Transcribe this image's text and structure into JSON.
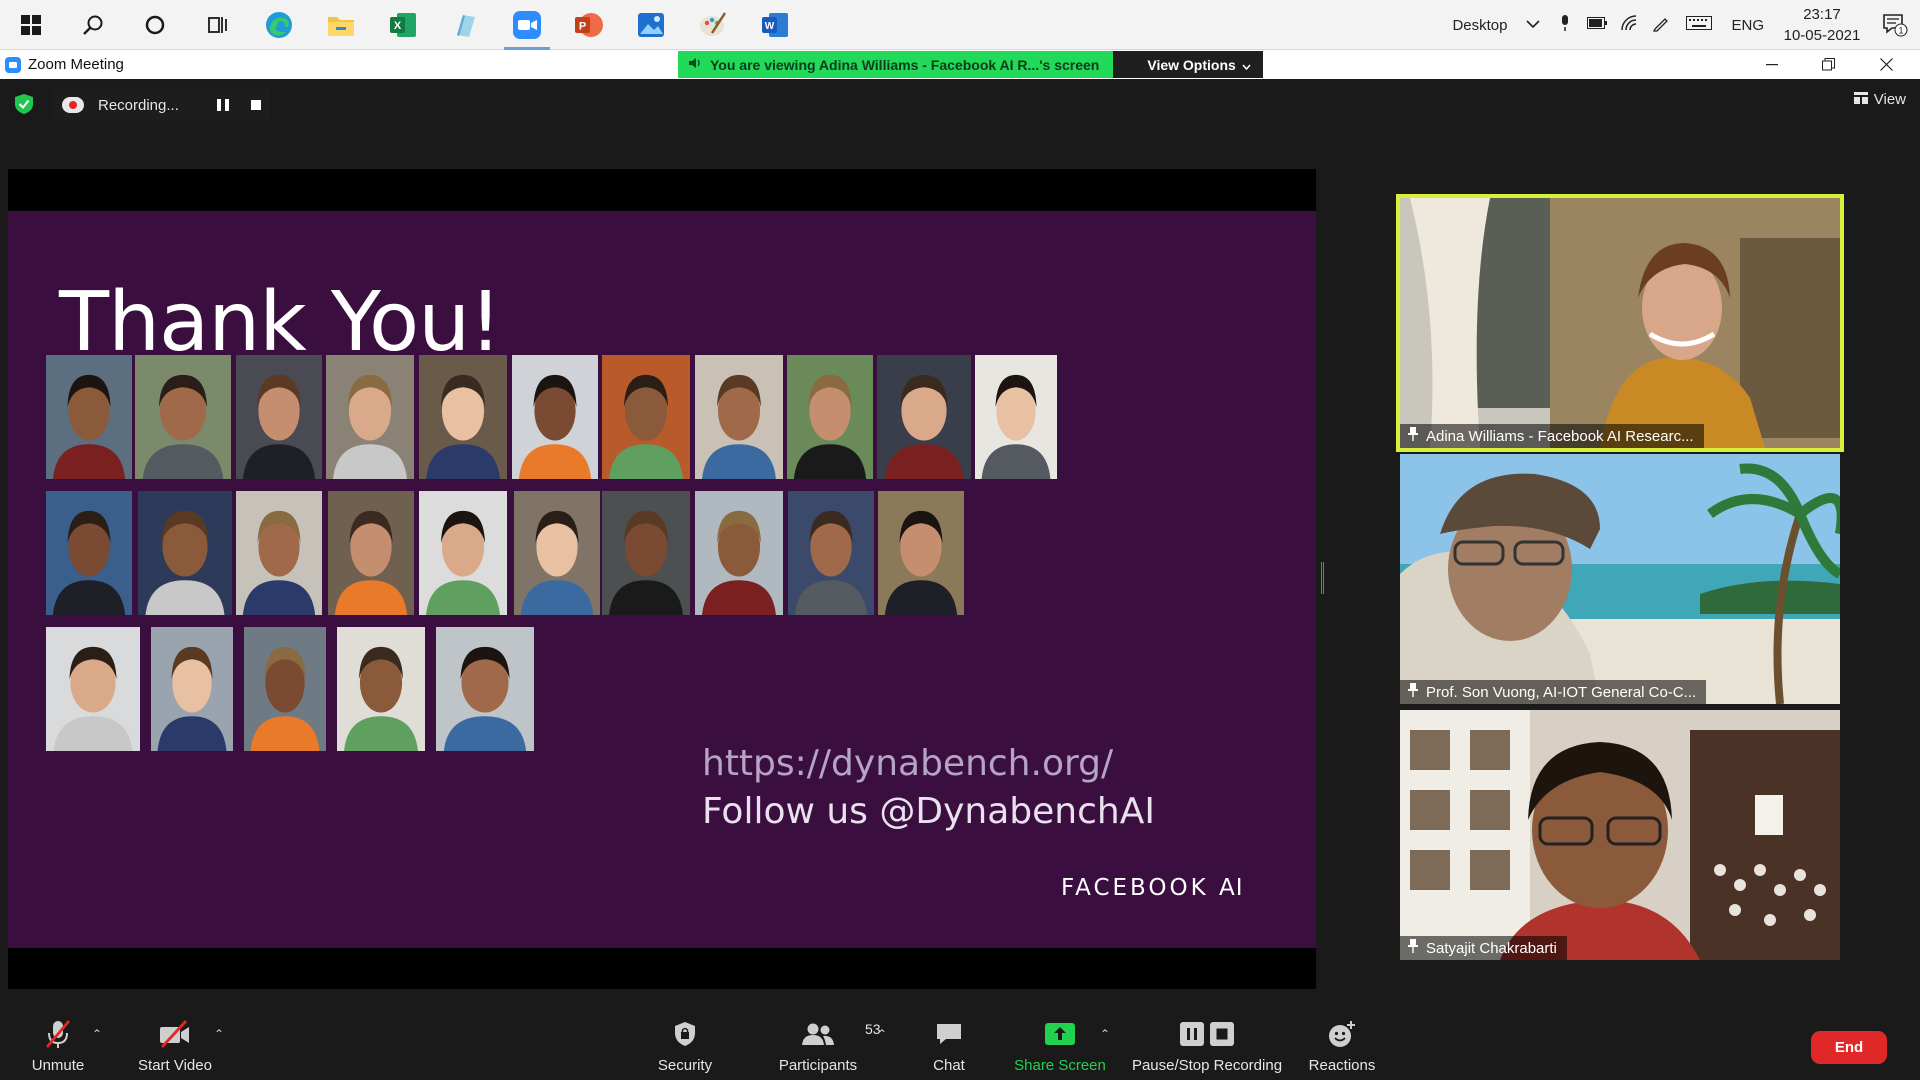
{
  "taskbar": {
    "apps": [
      {
        "name": "start-icon"
      },
      {
        "name": "search-icon"
      },
      {
        "name": "cortana-icon"
      },
      {
        "name": "task-view-icon"
      },
      {
        "name": "edge-icon"
      },
      {
        "name": "file-explorer-icon"
      },
      {
        "name": "excel-icon"
      },
      {
        "name": "generic-app-icon"
      },
      {
        "name": "zoom-icon"
      },
      {
        "name": "powerpoint-icon"
      },
      {
        "name": "photos-icon"
      },
      {
        "name": "paint-icon"
      },
      {
        "name": "word-icon"
      }
    ],
    "tray": {
      "desktop_label": "Desktop",
      "language": "ENG",
      "time": "23:17",
      "date": "10-05-2021",
      "notification_count": "1"
    }
  },
  "window": {
    "title": "Zoom Meeting",
    "share_banner": "You are viewing Adina Williams - Facebook AI R...'s screen",
    "view_options": "View Options"
  },
  "meeting": {
    "recording_label": "Recording...",
    "view_label": "View"
  },
  "slide": {
    "title": "Thank You!",
    "url": "https://dynabench.org/",
    "follow": "Follow us @DynabenchAI",
    "brand": "FACEBOOK",
    "brand_suffix": "AI"
  },
  "participants_video": [
    {
      "name": "Adina Williams - Facebook AI Researc...",
      "active": true
    },
    {
      "name": "Prof. Son Vuong, AI-IOT General Co-C...",
      "active": false
    },
    {
      "name": "Satyajit Chakrabarti",
      "active": false
    }
  ],
  "toolbar": {
    "unmute": "Unmute",
    "start_video": "Start Video",
    "security": "Security",
    "participants": "Participants",
    "participants_count": "53",
    "chat": "Chat",
    "share_screen": "Share Screen",
    "pause_stop_recording": "Pause/Stop Recording",
    "reactions": "Reactions",
    "end": "End"
  },
  "colors": {
    "slide_background": "#3a0e3f",
    "active_speaker_border": "#d8ef3b",
    "share_banner_green": "#23d959",
    "end_button": "#e02828",
    "share_screen_green": "#22d150"
  }
}
